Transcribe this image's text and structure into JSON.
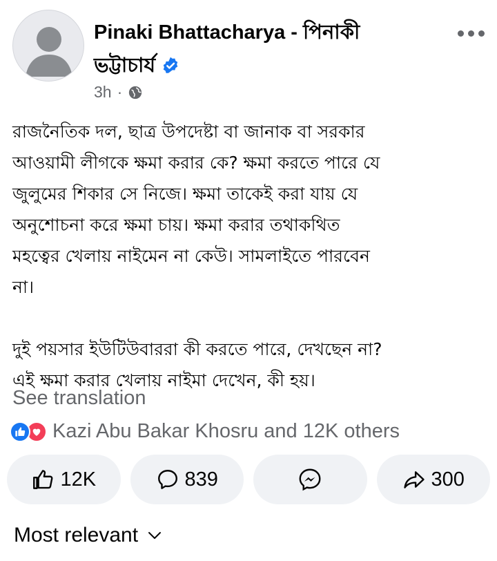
{
  "post": {
    "author_line1": "Pinaki Bhattacharya - পিনাকী",
    "author_line2": "ভট্টাচার্য",
    "time": "3h",
    "separator": "·",
    "body_para1": [
      "রাজনৈতিক দল, ছাত্র উপদেষ্টা বা জানাক বা সরকার",
      "আওয়ামী লীগকে ক্ষমা করার কে? ক্ষমা করতে পারে যে",
      "জুলুমের শিকার সে নিজে। ক্ষমা তাকেই করা যায় যে",
      "অনুশোচনা করে ক্ষমা চায়। ক্ষমা করার তথাকথিত",
      "মহত্বের খেলায় নাইমেন না কেউ। সামলাইতে পারবেন",
      "না।"
    ],
    "body_para2": [
      "দুই পয়সার ইউটিউবাররা কী করতে পারে, দেখছেন না?",
      "এই ক্ষমা করার খেলায় নাইমা দেখেন, কী হয়।"
    ],
    "see_translation": "See translation",
    "reactions_text": "Kazi Abu Bakar Khosru and 12K others"
  },
  "actions": {
    "like_count": "12K",
    "comment_count": "839",
    "share_count": "300"
  },
  "sort": {
    "label": "Most relevant"
  },
  "colors": {
    "accent": "#1877f2",
    "love": "#f33e58",
    "muted": "#65676b",
    "pill": "#f0f2f5"
  },
  "icons": [
    "avatar-placeholder",
    "verified-badge-icon",
    "globe-icon",
    "more-options-icon",
    "like-icon",
    "comment-icon",
    "messenger-icon",
    "share-icon",
    "chevron-down-icon"
  ]
}
